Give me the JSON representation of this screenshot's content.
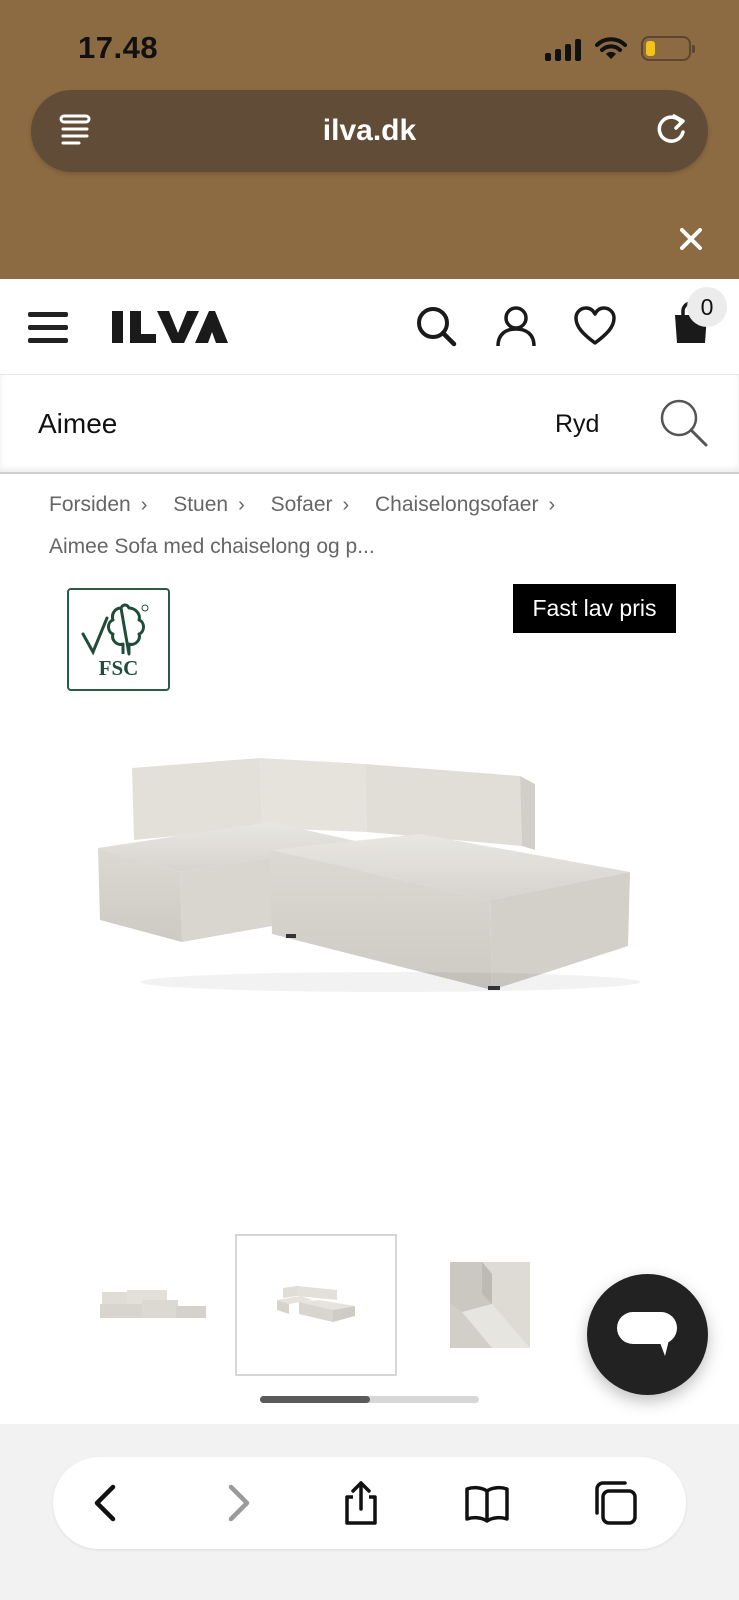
{
  "status_bar": {
    "time": "17.48"
  },
  "browser": {
    "url": "ilva.dk"
  },
  "header": {
    "cart_count": "0"
  },
  "search": {
    "value": "Aimee",
    "clear_label": "Ryd"
  },
  "breadcrumb": {
    "items": [
      "Forsiden",
      "Stuen",
      "Sofaer",
      "Chaiselongsofaer",
      "Aimee Sofa med chaiselong og p..."
    ]
  },
  "product": {
    "badge": "Fast lav pris",
    "fsc_label": "FSC"
  },
  "gallery": {
    "selected_index": 1,
    "scroll_position": 0.5
  },
  "colors": {
    "chrome_bg": "#8c6a42",
    "url_bar_bg": "#604c37",
    "fsc_green": "#1f4d3a",
    "badge_bg": "#000000",
    "chat_bg": "#222222"
  },
  "icons": {
    "url_left": "tab-overview-icon",
    "url_right": "reload-icon",
    "chrome_close": "close-icon",
    "menu": "hamburger-icon",
    "search": "search-icon",
    "account": "user-icon",
    "wishlist": "heart-icon",
    "cart": "shopping-bag-icon",
    "chat": "chat-bubble-icon",
    "nav": [
      "back-icon",
      "forward-icon",
      "share-icon",
      "bookmarks-icon",
      "tabs-icon"
    ]
  }
}
